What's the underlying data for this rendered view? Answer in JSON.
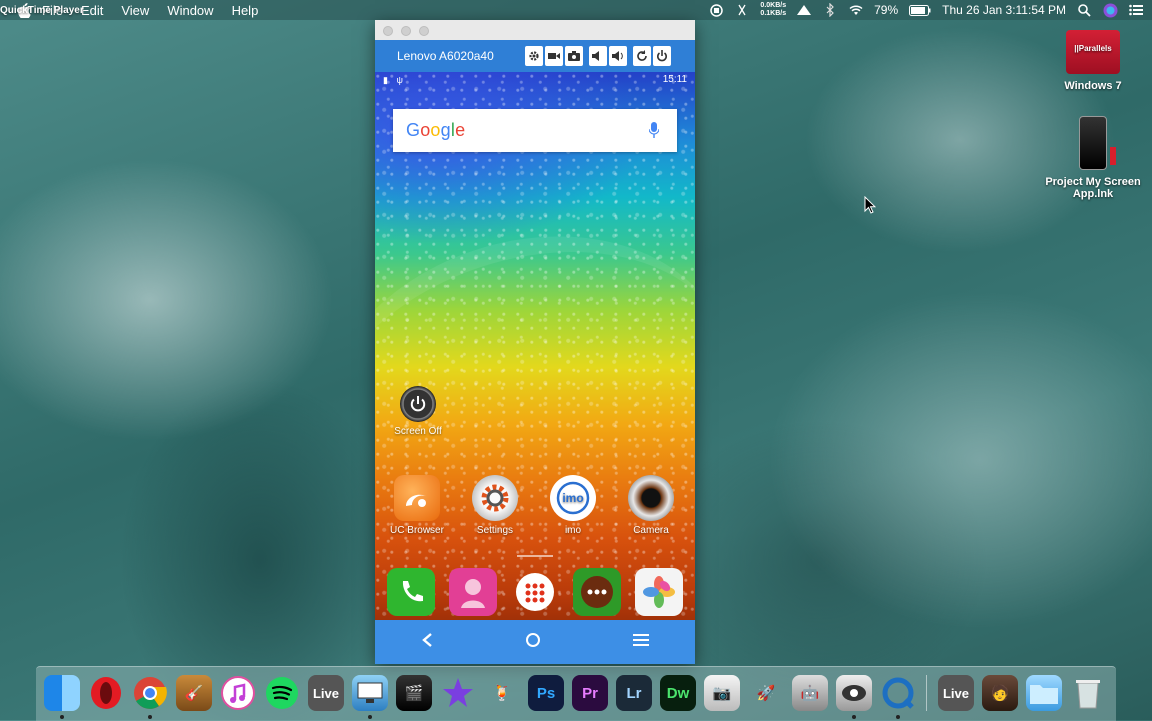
{
  "menubar": {
    "app_name": "QuickTime Player",
    "menus": [
      "File",
      "Edit",
      "View",
      "Window",
      "Help"
    ],
    "net_up": "0.0KB/s",
    "net_down": "0.1KB/s",
    "battery": "79%",
    "datetime": "Thu 26 Jan  3:11:54 PM"
  },
  "phone_window": {
    "device_name": "Lenovo A6020a40",
    "clock": "15:11",
    "google_search": {
      "logo": "Google"
    },
    "screen_off_label": "Screen Off",
    "apps": [
      {
        "label": "UC Browser",
        "color": "#f07a1a"
      },
      {
        "label": "Settings",
        "color": "#8a8a8a"
      },
      {
        "label": "imo",
        "color": "#ffffff"
      },
      {
        "label": "Camera",
        "color": "#e06020"
      }
    ],
    "dock_colors": [
      "#38b838",
      "#e6409a",
      "#ffffff",
      "#3fa82f",
      "#f0f0f0"
    ]
  },
  "desktop": {
    "icons": [
      {
        "label": "Windows 7",
        "badge": "||Parallels"
      },
      {
        "label": "Project My Screen App.lnk"
      }
    ]
  },
  "dock_text": {
    "live1": "Live",
    "ps": "Ps",
    "pr": "Pr",
    "lr": "Lr",
    "dw": "Dw",
    "live2": "Live"
  }
}
